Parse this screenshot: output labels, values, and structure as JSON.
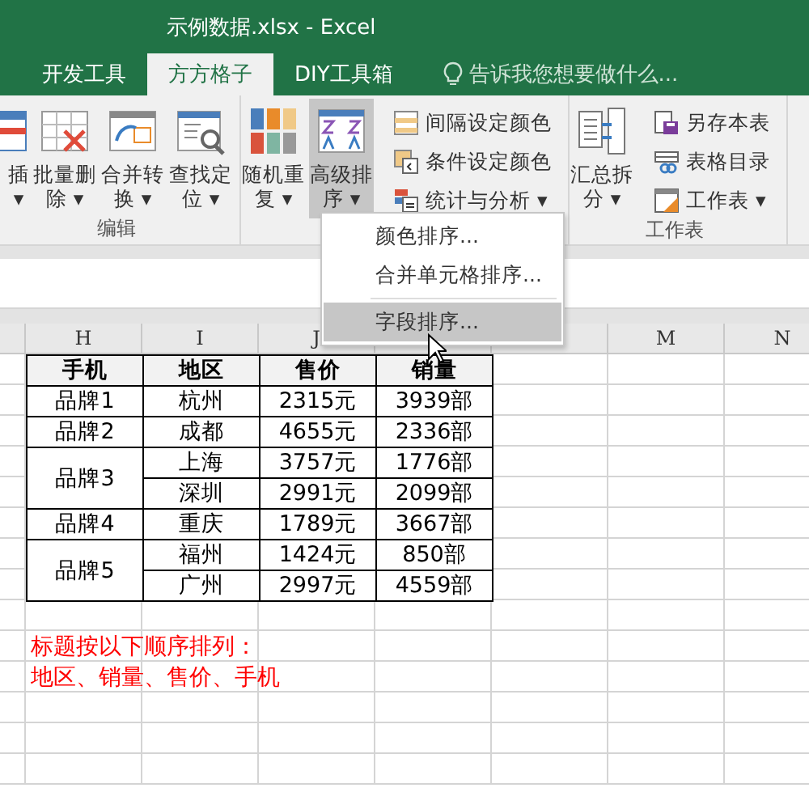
{
  "window": {
    "title": "示例数据.xlsx - Excel"
  },
  "tabs": [
    {
      "label": "开发工具",
      "selected": false
    },
    {
      "label": "方方格子",
      "selected": true
    },
    {
      "label": "DIY工具箱",
      "selected": false
    }
  ],
  "tell_me": {
    "placeholder": "告诉我您想要做什么..."
  },
  "ribbon": {
    "groups": [
      {
        "label": "编辑",
        "large": [
          {
            "lines": [
              "插",
              "▾"
            ],
            "pressed": false,
            "cut": true
          },
          {
            "lines": [
              "批量删",
              "除 ▾"
            ],
            "pressed": false,
            "cut": false
          },
          {
            "lines": [
              "合并转",
              "换 ▾"
            ],
            "pressed": false,
            "cut": false
          },
          {
            "lines": [
              "查找定",
              "位 ▾"
            ],
            "pressed": false,
            "cut": false
          }
        ]
      },
      {
        "large": [
          {
            "lines": [
              "随机重",
              "复 ▾"
            ],
            "pressed": false,
            "cut": false
          },
          {
            "lines": [
              "高级排",
              "序 ▾"
            ],
            "pressed": true,
            "cut": false
          }
        ],
        "small": [
          {
            "label": "间隔设定颜色"
          },
          {
            "label": "条件设定颜色"
          },
          {
            "label": "统计与分析 ▾"
          }
        ]
      },
      {
        "label": "工作表",
        "large": [
          {
            "lines": [
              "汇总拆",
              "分 ▾"
            ],
            "pressed": false,
            "cut": false
          }
        ],
        "small": [
          {
            "label": "另存本表"
          },
          {
            "label": "表格目录"
          },
          {
            "label": "工作表 ▾"
          }
        ]
      }
    ]
  },
  "sort_menu": {
    "items": [
      {
        "label": "颜色排序...",
        "selected": false
      },
      {
        "label": "合并单元格排序...",
        "selected": false
      },
      {
        "label": "字段排序...",
        "selected": true
      }
    ]
  },
  "columns": [
    {
      "label": "H"
    },
    {
      "label": "I"
    },
    {
      "label": "J"
    },
    {},
    {},
    {
      "label": "M"
    },
    {
      "label": "N"
    }
  ],
  "table": {
    "headers": [
      "手机",
      "地区",
      "售价",
      "销量"
    ],
    "brands": [
      {
        "name": "品牌1",
        "entries": [
          {
            "region": "杭州",
            "price": "2315元",
            "sales": "3939部"
          }
        ]
      },
      {
        "name": "品牌2",
        "entries": [
          {
            "region": "成都",
            "price": "4655元",
            "sales": "2336部"
          }
        ]
      },
      {
        "name": "品牌3",
        "entries": [
          {
            "region": "上海",
            "price": "3757元",
            "sales": "1776部"
          },
          {
            "region": "深圳",
            "price": "2991元",
            "sales": "2099部"
          }
        ]
      },
      {
        "name": "品牌4",
        "entries": [
          {
            "region": "重庆",
            "price": "1789元",
            "sales": "3667部"
          }
        ]
      },
      {
        "name": "品牌5",
        "entries": [
          {
            "region": "福州",
            "price": "1424元",
            "sales": "850部"
          },
          {
            "region": "广州",
            "price": "2997元",
            "sales": "4559部"
          }
        ]
      }
    ]
  },
  "notes": [
    "标题按以下顺序排列：",
    "地区、销量、售价、手机"
  ]
}
